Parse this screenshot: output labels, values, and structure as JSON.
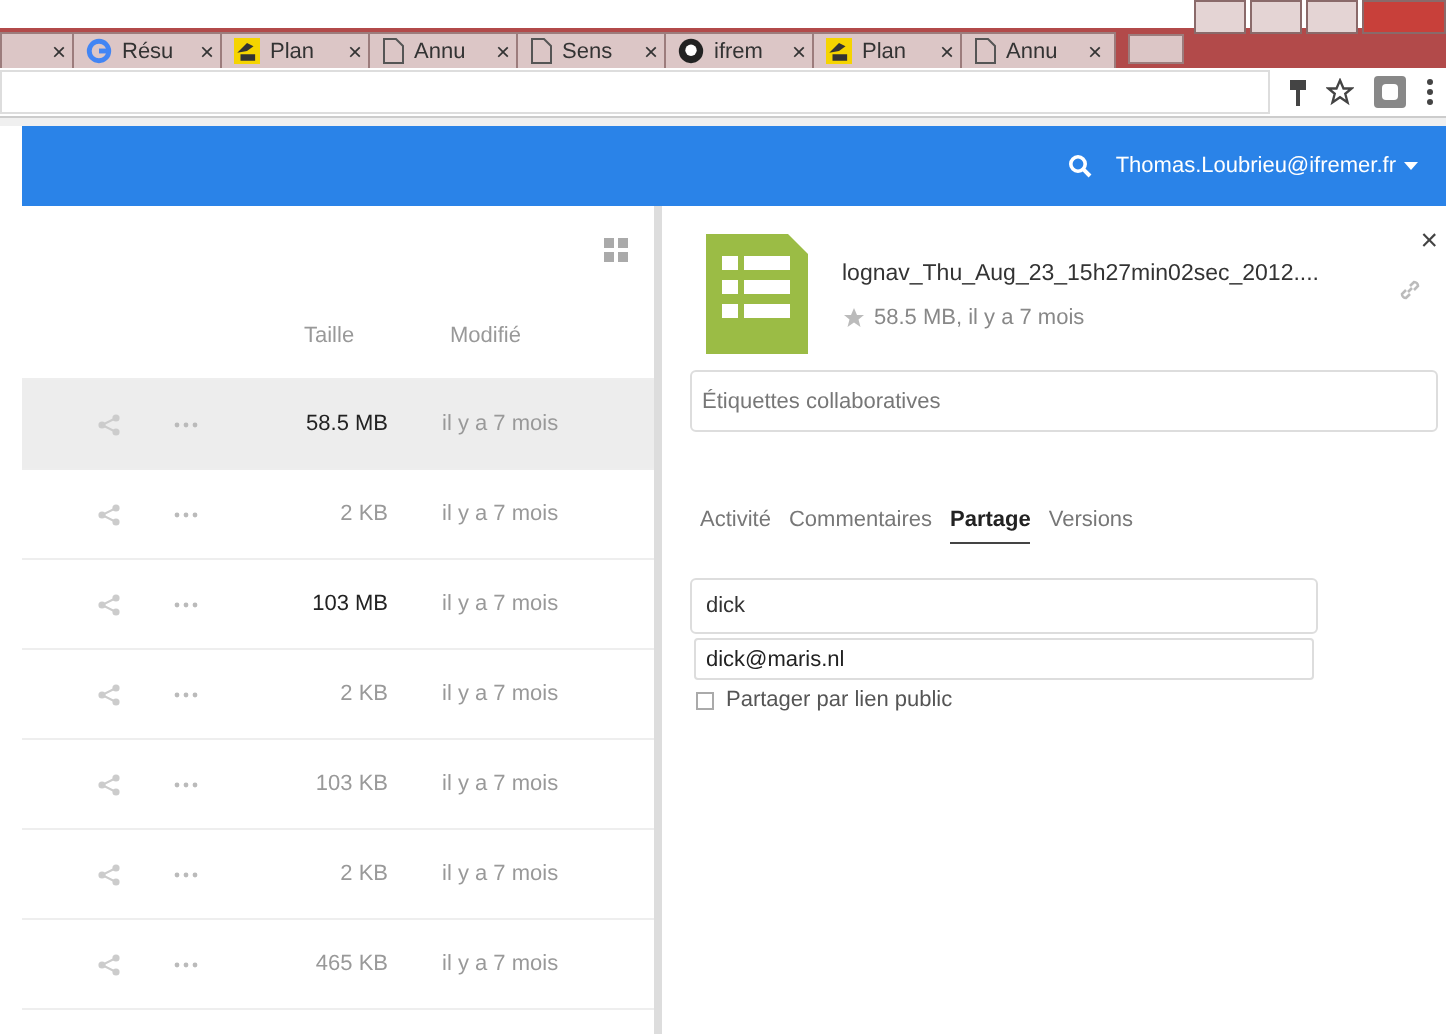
{
  "browser": {
    "tabs": [
      {
        "kind": "none",
        "close": "×"
      },
      {
        "kind": "google",
        "title": "Résu",
        "close": "×"
      },
      {
        "kind": "ifr",
        "title": "Plan",
        "close": "×"
      },
      {
        "kind": "page",
        "title": "Annu",
        "close": "×"
      },
      {
        "kind": "page",
        "title": "Sens",
        "close": "×"
      },
      {
        "kind": "github",
        "title": "ifrem",
        "close": "×"
      },
      {
        "kind": "ifr",
        "title": "Plan",
        "close": "×"
      },
      {
        "kind": "page",
        "title": "Annu",
        "close": "×"
      }
    ]
  },
  "header": {
    "user": "Thomas.Loubrieu@ifremer.fr"
  },
  "file_list": {
    "columns": [
      "Taille",
      "Modifié"
    ],
    "rows": [
      {
        "size": "58.5 MB",
        "modified": "il y a 7 mois",
        "selected": true,
        "large": true
      },
      {
        "size": "2 KB",
        "modified": "il y a 7 mois",
        "selected": false,
        "large": false
      },
      {
        "size": "103 MB",
        "modified": "il y a 7 mois",
        "selected": false,
        "large": true
      },
      {
        "size": "2 KB",
        "modified": "il y a 7 mois",
        "selected": false,
        "large": false
      },
      {
        "size": "103 KB",
        "modified": "il y a 7 mois",
        "selected": false,
        "large": false
      },
      {
        "size": "2 KB",
        "modified": "il y a 7 mois",
        "selected": false,
        "large": false
      },
      {
        "size": "465 KB",
        "modified": "il y a 7 mois",
        "selected": false,
        "large": false
      }
    ]
  },
  "sidebar": {
    "file_name": "lognav_Thu_Aug_23_15h27min02sec_2012....",
    "favorite": false,
    "meta": "58.5 MB, il y a 7 mois",
    "close": "×",
    "tags": {
      "placeholder": "Étiquettes collaboratives"
    },
    "tabs": [
      {
        "label": "Activité",
        "selected": false
      },
      {
        "label": "Commentaires",
        "selected": false
      },
      {
        "label": "Partage",
        "selected": true
      },
      {
        "label": "Versions",
        "selected": false
      }
    ],
    "share_input": {
      "value": "dick"
    },
    "suggestions": [
      "dick@maris.nl"
    ],
    "public_link": {
      "label": "Partager par lien public",
      "checked": false
    }
  }
}
